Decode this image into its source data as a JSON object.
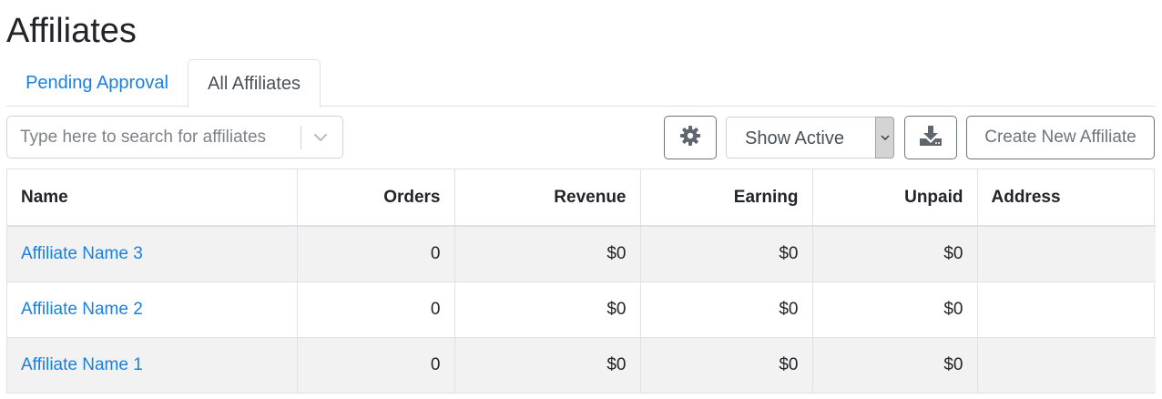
{
  "page": {
    "title": "Affiliates"
  },
  "tabs": [
    {
      "label": "Pending Approval",
      "active": false
    },
    {
      "label": "All Affiliates",
      "active": true
    }
  ],
  "toolbar": {
    "search_placeholder": "Type here to search for affiliates",
    "search_value": "",
    "filter_select_value": "Show Active",
    "create_label": "Create New Affiliate",
    "settings_icon": "gear-icon",
    "download_icon": "download-icon"
  },
  "table": {
    "columns": [
      "Name",
      "Orders",
      "Revenue",
      "Earning",
      "Unpaid",
      "Address"
    ],
    "rows": [
      {
        "name": "Affiliate Name 3",
        "orders": "0",
        "revenue": "$0",
        "earning": "$0",
        "unpaid": "$0",
        "address": ""
      },
      {
        "name": "Affiliate Name 2",
        "orders": "0",
        "revenue": "$0",
        "earning": "$0",
        "unpaid": "$0",
        "address": ""
      },
      {
        "name": "Affiliate Name 1",
        "orders": "0",
        "revenue": "$0",
        "earning": "$0",
        "unpaid": "$0",
        "address": ""
      }
    ]
  },
  "colors": {
    "link": "#1a7fe0",
    "row_stripe": "#f2f2f2",
    "border": "#dee2e6",
    "button_border": "#6c757d"
  }
}
